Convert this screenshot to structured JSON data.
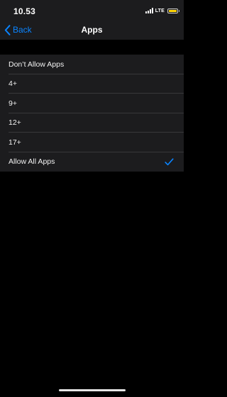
{
  "status_bar": {
    "time": "10.53",
    "network": "LTE",
    "signal_icon": "signal-bars-icon",
    "battery_icon": "battery-icon",
    "battery_color": "#ffd60a"
  },
  "nav": {
    "back_label": "Back",
    "back_icon": "chevron-left-icon",
    "title": "Apps",
    "accent_color": "#0a84ff"
  },
  "options": [
    {
      "label": "Don’t Allow Apps",
      "selected": false
    },
    {
      "label": "4+",
      "selected": false
    },
    {
      "label": "9+",
      "selected": false
    },
    {
      "label": "12+",
      "selected": false
    },
    {
      "label": "17+",
      "selected": false
    },
    {
      "label": "Allow All Apps",
      "selected": true
    }
  ],
  "checkmark_icon": "checkmark-icon"
}
